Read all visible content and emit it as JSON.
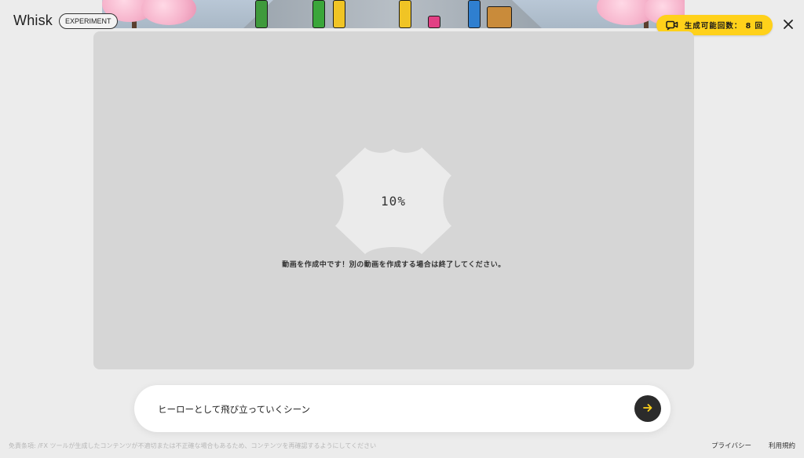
{
  "header": {
    "brand_name": "Whisk",
    "brand_badge": "EXPERIMENT",
    "credits_label": "生成可能回数： 8 回",
    "close_icon": "close-icon",
    "credits_icon": "video-add-icon",
    "accent_color": "#ffd11a"
  },
  "generation": {
    "progress_text": "10%",
    "status_message": "動画を作成中です！別の動画を作成する場合は終了してください。"
  },
  "prompt": {
    "value": "ヒーローとして飛び立っていくシーン",
    "send_icon": "arrow-right-icon"
  },
  "footer": {
    "disclaimer": "免責条項: /FX ツールが生成したコンテンツが不適切または不正確な場合もあるため、コンテンツを再確認するようにしてください",
    "privacy_label": "プライバシー",
    "terms_label": "利用規約"
  }
}
